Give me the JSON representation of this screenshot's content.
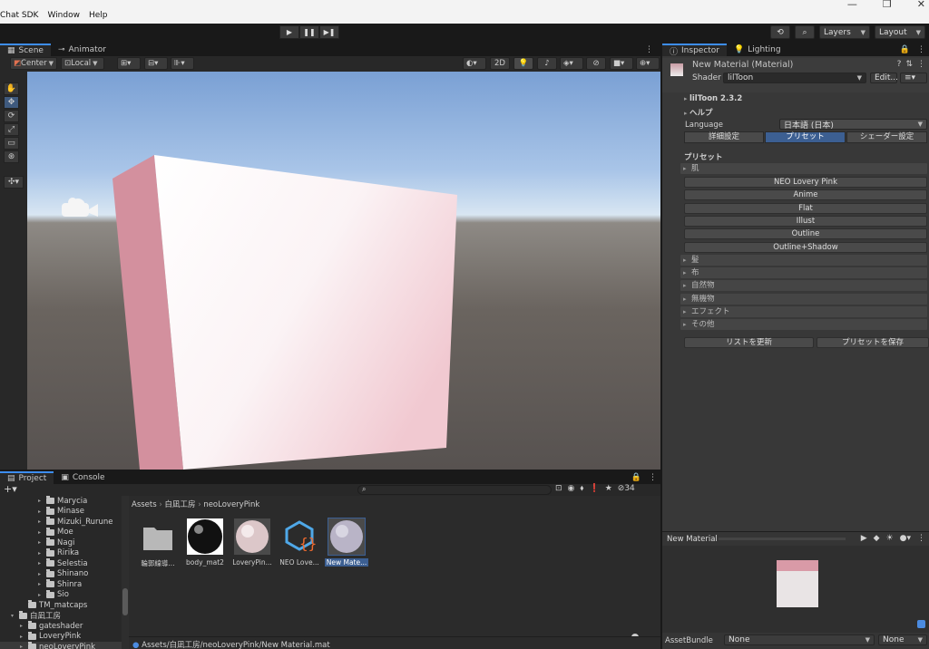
{
  "menubar": {
    "items": [
      "Chat SDK",
      "Window",
      "Help"
    ],
    "window_controls": [
      "—",
      "❐",
      "✕"
    ]
  },
  "toolbar": {
    "play": "▶",
    "pause": "❚❚",
    "step": "▶❚",
    "layers_label": "Layers",
    "layout_label": "Layout"
  },
  "scene": {
    "tabs": [
      "Scene",
      "Animator"
    ],
    "pivot_mode": "Center",
    "pivot_rotation": "Local",
    "toggle_2d": "2D"
  },
  "inspector": {
    "tabs": [
      "Inspector",
      "Lighting"
    ],
    "material_title": "New Material (Material)",
    "shader_label": "Shader",
    "shader_value": "lilToon",
    "edit_label": "Edit...",
    "version_label": "lilToon 2.3.2",
    "help_label": "ヘルプ",
    "language_label": "Language",
    "language_value": "日本語 (日本)",
    "mode_tabs": [
      "詳細設定",
      "プリセット",
      "シェーダー設定"
    ],
    "presets_heading": "プリセット",
    "skin_group": "肌",
    "skin_presets": [
      "NEO Lovery Pink",
      "Anime",
      "Flat",
      "Illust",
      "Outline",
      "Outline+Shadow"
    ],
    "other_groups": [
      "髪",
      "布",
      "自然物",
      "無機物",
      "エフェクト",
      "その他"
    ],
    "refresh_button": "リストを更新",
    "save_button": "プリセットを保存"
  },
  "preview": {
    "title": "New Material"
  },
  "assetbundle": {
    "label": "AssetBundle",
    "bundle_value": "None",
    "variant_value": "None"
  },
  "project": {
    "tabs": [
      "Project",
      "Console"
    ],
    "search_placeholder": "",
    "hidden_count": "34",
    "tree": [
      {
        "label": "Marycia",
        "level": 2
      },
      {
        "label": "Minase",
        "level": 2
      },
      {
        "label": "Mizuki_Rurune",
        "level": 2
      },
      {
        "label": "Moe",
        "level": 2
      },
      {
        "label": "Nagi",
        "level": 2
      },
      {
        "label": "Ririka",
        "level": 2
      },
      {
        "label": "Selestia",
        "level": 2
      },
      {
        "label": "Shinano",
        "level": 2
      },
      {
        "label": "Shinra",
        "level": 2
      },
      {
        "label": "Sio",
        "level": 2
      },
      {
        "label": "TM_matcaps",
        "level": 1
      },
      {
        "label": "白凪工房",
        "level": 0
      },
      {
        "label": "gateshader",
        "level": 1
      },
      {
        "label": "LoveryPink",
        "level": 1
      },
      {
        "label": "neoLoveryPink",
        "level": 1
      }
    ],
    "breadcrumb": [
      "Assets",
      "白凪工房",
      "neoLoveryPink"
    ],
    "assets": [
      {
        "label": "輪郭線導...",
        "kind": "folder"
      },
      {
        "label": "body_mat2",
        "kind": "material-dark"
      },
      {
        "label": "LoveryPin...",
        "kind": "material-pink"
      },
      {
        "label": "NEO Love...",
        "kind": "shader"
      },
      {
        "label": "New Mate...",
        "kind": "material-selected"
      }
    ],
    "path_bar": "Assets/白凪工房/neoLoveryPink/New Material.mat"
  },
  "colors": {
    "accent": "#3d8df0",
    "selection": "#3c5f92",
    "panel": "#383838"
  }
}
